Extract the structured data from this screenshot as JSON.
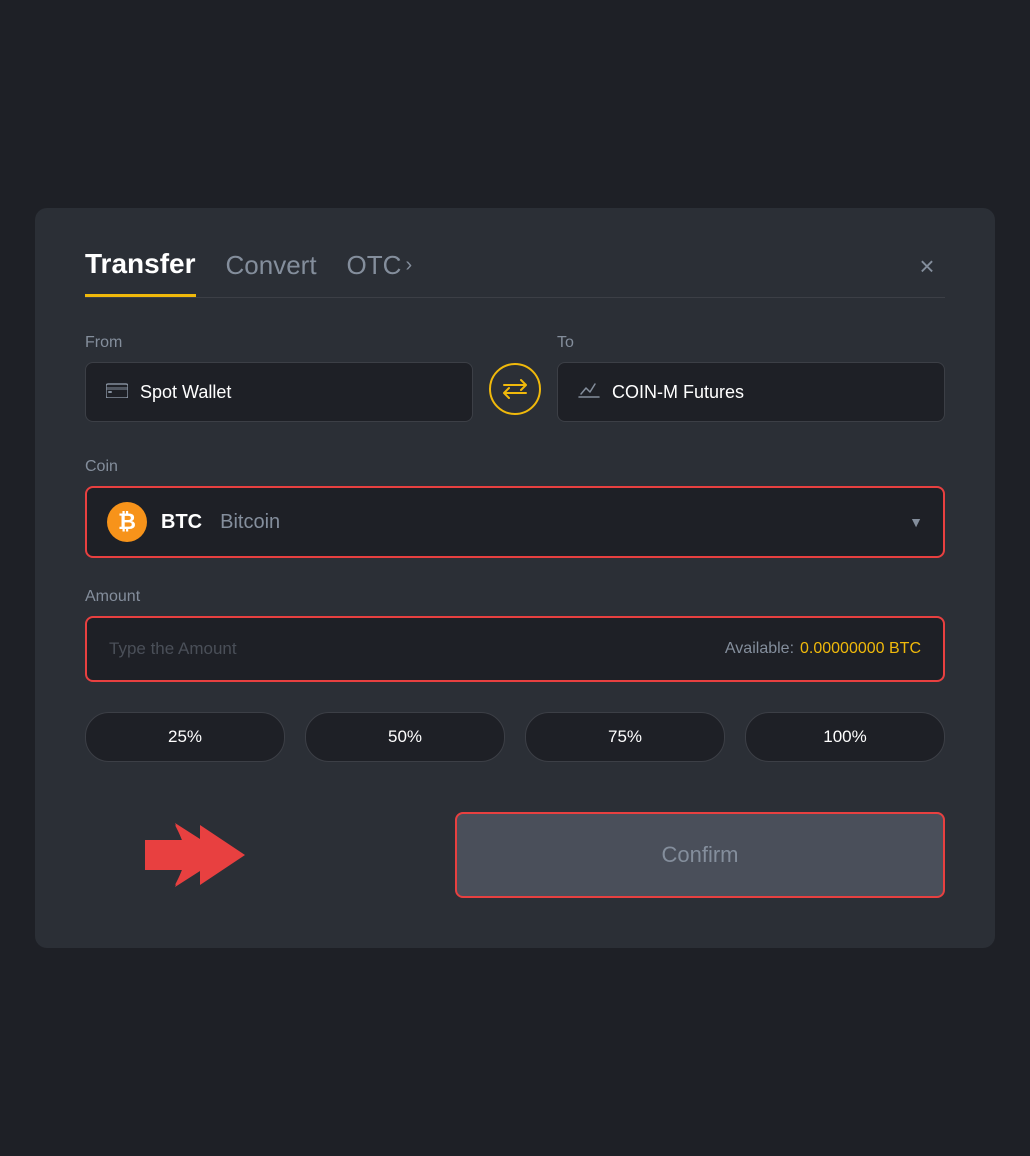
{
  "modal": {
    "tabs": {
      "transfer": "Transfer",
      "convert": "Convert",
      "otc": "OTC"
    },
    "close_icon": "×",
    "from_label": "From",
    "to_label": "To",
    "from_wallet": "Spot Wallet",
    "to_wallet": "COIN-M Futures",
    "swap_icon": "⇄",
    "coin_label": "Coin",
    "coin_ticker": "BTC",
    "coin_name": "Bitcoin",
    "amount_label": "Amount",
    "amount_placeholder": "Type the Amount",
    "available_label": "Available:",
    "available_value": "0.00000000",
    "available_currency": "BTC",
    "percentages": [
      "25%",
      "50%",
      "75%",
      "100%"
    ],
    "confirm_label": "Confirm"
  }
}
